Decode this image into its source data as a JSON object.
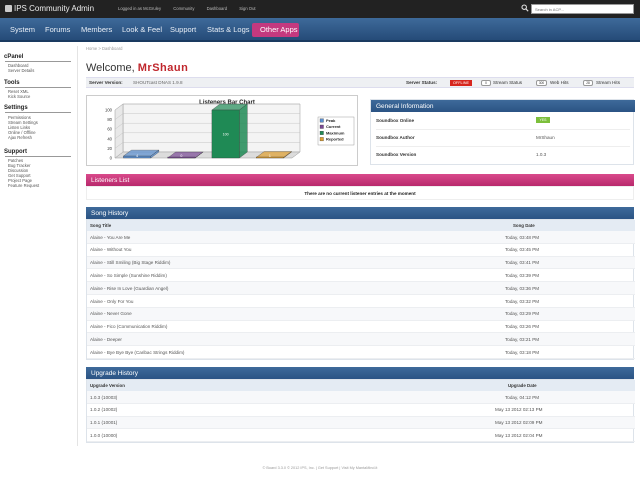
{
  "topbar": {
    "logo_text": "IPS Community Admin",
    "links": [
      "Logged in as McGruley",
      "Community",
      "Dashboard",
      "Sign Out"
    ],
    "search_placeholder": "Search in ACP..."
  },
  "nav": {
    "items": [
      "System",
      "Forums",
      "Members",
      "Look & Feel",
      "Support",
      "Stats & Logs"
    ],
    "active": "Other Apps"
  },
  "breadcrumb": "Home > Dashboard",
  "sidebar": {
    "sections": [
      {
        "title": "cPanel",
        "links": [
          "Dashboard",
          "Server Details"
        ]
      },
      {
        "title": "Tools",
        "links": [
          "Reset XML",
          "Kick Source"
        ]
      },
      {
        "title": "Settings",
        "links": [
          "Permissions",
          "Stream Settings",
          "Listen Links",
          "Online / Offline",
          "Ajax Refresh"
        ]
      },
      {
        "title": "Support",
        "links": [
          "Patches",
          "Bug Tracker",
          "Discussion",
          "Get Support",
          "Project Page",
          "Feature Request"
        ]
      }
    ]
  },
  "welcome": {
    "prefix": "Welcome,",
    "name": "MrShaun"
  },
  "server": {
    "version_label": "Server Version:",
    "version_value": "SHOUTcast DNAS 1.9.8",
    "status_label": "Server Status:",
    "status_value": "OFFLINE",
    "buttons": [
      {
        "badge": "0",
        "label": "Stream Status"
      },
      {
        "badge": "300",
        "label": "Web Hits"
      },
      {
        "badge": "28",
        "label": "Stream Hits"
      }
    ]
  },
  "chart_data": {
    "type": "bar",
    "title": "Listeners Bar Chart",
    "categories": [
      "Peak",
      "Current",
      "Maximum",
      "Reported"
    ],
    "values": [
      4,
      0,
      100,
      1
    ],
    "ylim": [
      0,
      100
    ],
    "yticks": [
      0,
      20,
      40,
      60,
      80,
      100
    ],
    "colors": [
      "#5a8fd0",
      "#7b4a96",
      "#1f8a55",
      "#e0a030"
    ],
    "legend_position": "right",
    "grid": true
  },
  "general": {
    "title": "General Information",
    "rows": [
      {
        "label": "Soundbox Online",
        "value": "YES"
      },
      {
        "label": "Soundbox Author",
        "value": "MrShaun"
      },
      {
        "label": "Soundbox Version",
        "value": "1.0.3"
      }
    ]
  },
  "listeners": {
    "title": "Listeners List",
    "empty": "There are no current listener entries at the moment"
  },
  "songs": {
    "title": "Song History",
    "col_title": "Song Title",
    "col_date": "Song Date",
    "rows": [
      {
        "title": "Alaine - You Are Me",
        "date": "Today, 03:48 PM"
      },
      {
        "title": "Alaine - Without You",
        "date": "Today, 03:45 PM"
      },
      {
        "title": "Alaine - Still Smiling (Big Stage Riddim)",
        "date": "Today, 03:41 PM"
      },
      {
        "title": "Alaine - So Simple (Sunshine Riddim)",
        "date": "Today, 03:39 PM"
      },
      {
        "title": "Alaine - Rise In Love (Guardian Angel)",
        "date": "Today, 03:36 PM"
      },
      {
        "title": "Alaine - Only For You",
        "date": "Today, 03:32 PM"
      },
      {
        "title": "Alaine - Never Gone",
        "date": "Today, 03:29 PM"
      },
      {
        "title": "Alaine - Fico (Communication Riddim)",
        "date": "Today, 03:26 PM"
      },
      {
        "title": "Alaine - Deeper",
        "date": "Today, 03:21 PM"
      },
      {
        "title": "Alaine - Bye Bye Bye (Caribac Strings Riddim)",
        "date": "Today, 03:18 PM"
      }
    ]
  },
  "upgrades": {
    "title": "Upgrade History",
    "col_version": "Upgrade Version",
    "col_date": "Upgrade Date",
    "rows": [
      {
        "version": "1.0.3 (10003)",
        "date": "Today, 04:12 PM"
      },
      {
        "version": "1.0.2 (10002)",
        "date": "May 13 2012 02:13 PM"
      },
      {
        "version": "1.0.1 (10001)",
        "date": "May 13 2012 02:09 PM"
      },
      {
        "version": "1.0.0 (10000)",
        "date": "May 13 2012 02:04 PM"
      }
    ]
  },
  "footer": "© Board 3.3.0 © 2012 IPS, Inc.  |  Get Support  |  Visit My MantaMind.it"
}
